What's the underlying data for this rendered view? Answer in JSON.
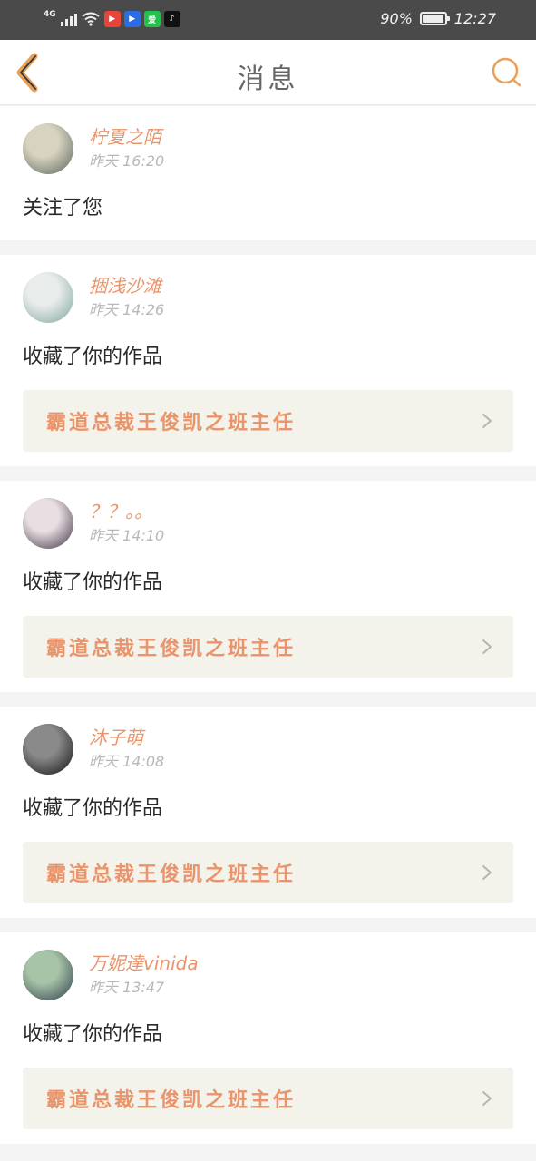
{
  "status_bar": {
    "network": "4G",
    "battery": "90%",
    "battery_level": 0.9,
    "time": "12:27",
    "app_icons": [
      {
        "name": "video-app-icon",
        "color": "#e8443a",
        "glyph": "▶"
      },
      {
        "name": "tencent-video-icon",
        "color": "#2b6de6",
        "glyph": "▶"
      },
      {
        "name": "iqiyi-icon",
        "color": "#21c14a",
        "glyph": "爱"
      },
      {
        "name": "tiktok-icon",
        "color": "#111111",
        "glyph": "♪"
      }
    ]
  },
  "nav": {
    "title": "消息",
    "back_icon": "back-chevron-icon",
    "search_icon": "search-icon",
    "accent_color": "#e9a15a"
  },
  "messages": [
    {
      "user": "柠夏之陌",
      "time": "昨天 16:20",
      "action": "关注了您",
      "work": null,
      "avatar_colors": [
        "#d8d3c0",
        "#56645a"
      ]
    },
    {
      "user": "捆浅沙滩",
      "time": "昨天 14:26",
      "action": "收藏了你的作品",
      "work": "霸道总裁王俊凯之班主任",
      "avatar_colors": [
        "#e8eceb",
        "#7fa59d"
      ]
    },
    {
      "user": "？？。。",
      "time": "昨天 14:10",
      "action": "收藏了你的作品",
      "work": "霸道总裁王俊凯之班主任",
      "avatar_colors": [
        "#e9dfe3",
        "#3b3040"
      ]
    },
    {
      "user": "沐子萌",
      "time": "昨天 14:08",
      "action": "收藏了你的作品",
      "work": "霸道总裁王俊凯之班主任",
      "avatar_colors": [
        "#8a8a8a",
        "#111111"
      ]
    },
    {
      "user": "万妮達vinida",
      "time": "昨天 13:47",
      "action": "收藏了你的作品",
      "work": "霸道总裁王俊凯之班主任",
      "avatar_colors": [
        "#a7c4a8",
        "#2d3b4a"
      ]
    }
  ]
}
